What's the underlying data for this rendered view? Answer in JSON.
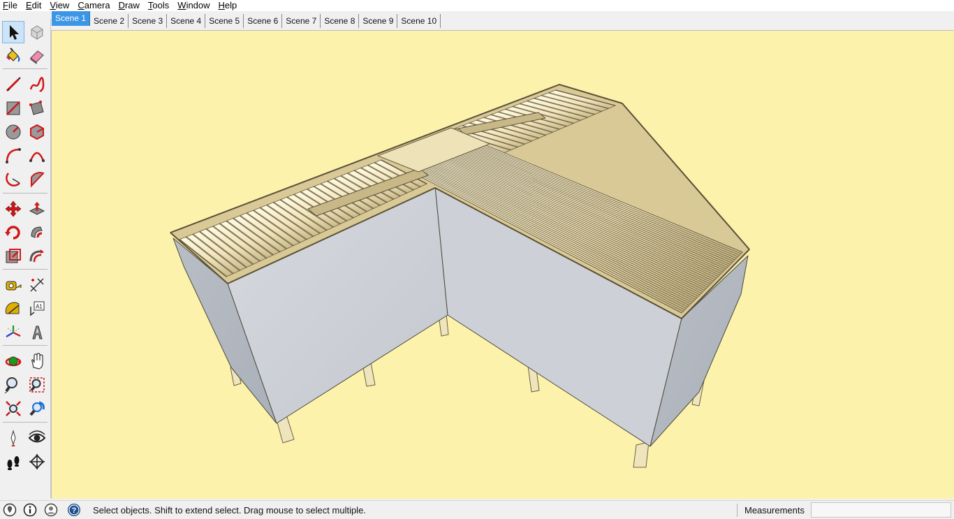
{
  "menu": {
    "items": [
      {
        "accel": "F",
        "rest": "ile"
      },
      {
        "accel": "E",
        "rest": "dit"
      },
      {
        "accel": "V",
        "rest": "iew"
      },
      {
        "accel": "C",
        "rest": "amera"
      },
      {
        "accel": "D",
        "rest": "raw"
      },
      {
        "accel": "T",
        "rest": "ools"
      },
      {
        "accel": "W",
        "rest": "indow"
      },
      {
        "accel": "H",
        "rest": "elp"
      }
    ]
  },
  "scenes": {
    "tabs": [
      "Scene 1",
      "Scene 2",
      "Scene 3",
      "Scene 4",
      "Scene 5",
      "Scene 6",
      "Scene 7",
      "Scene 8",
      "Scene 9",
      "Scene 10"
    ],
    "active_index": 0
  },
  "toolbar": {
    "tools": [
      "select-icon",
      "make-component-icon",
      "paint-bucket-icon",
      "eraser-icon",
      "line-icon",
      "freehand-icon",
      "rectangle-icon",
      "rotated-rectangle-icon",
      "circle-icon",
      "polygon-icon",
      "arc-icon",
      "two-point-arc-icon",
      "three-point-arc-icon",
      "pie-icon",
      "move-icon",
      "push-pull-icon",
      "rotate-icon",
      "follow-me-icon",
      "scale-icon",
      "offset-icon",
      "tape-measure-icon",
      "dimension-icon",
      "protractor-icon",
      "text-icon",
      "axes-icon",
      "3d-text-icon",
      "orbit-icon",
      "pan-icon",
      "zoom-icon",
      "zoom-window-icon",
      "zoom-extents-icon",
      "previous-view-icon",
      "position-camera-icon",
      "look-around-icon",
      "walk-icon",
      "section-plane-icon"
    ],
    "selected": "select-icon"
  },
  "viewport": {
    "background_color": "#fdf2ac",
    "model": "L-shaped roller conveyor table model"
  },
  "status": {
    "icons": [
      "geo-location-icon",
      "credits-icon",
      "account-icon",
      "help-icon"
    ],
    "message": "Select objects. Shift to extend select. Drag mouse to select multiple.",
    "measurements_label": "Measurements",
    "measurements_value": ""
  },
  "colors": {
    "accent": "#3c96e6",
    "panel_face": "#c9ccd2",
    "roller": "#efe3b8",
    "frame": "#a99a70"
  }
}
